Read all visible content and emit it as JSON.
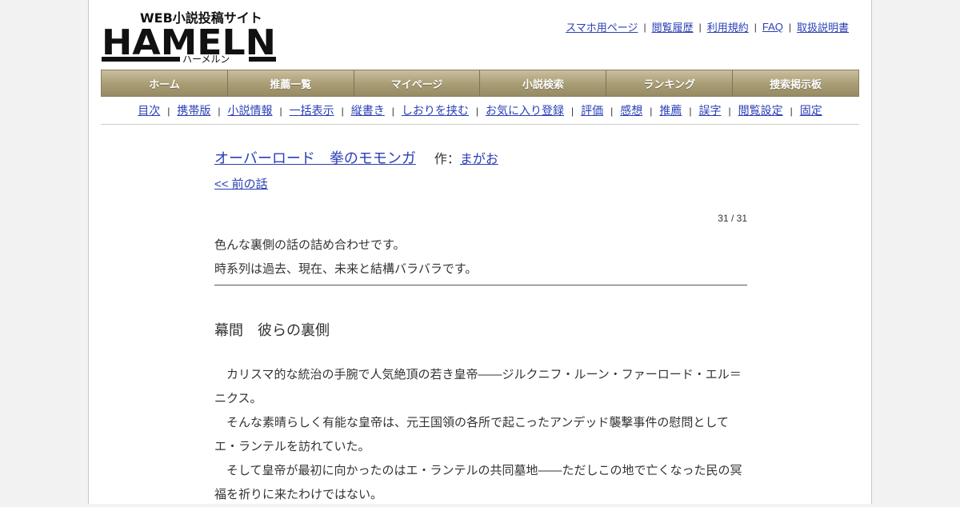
{
  "logo": {
    "tagline": "WEB小説投稿サイト",
    "name": "HAMELN",
    "kana": "ハーメルン"
  },
  "header_links": [
    "スマホ用ページ",
    "閲覧履歴",
    "利用規約",
    "FAQ",
    "取扱説明書"
  ],
  "nav": [
    "ホーム",
    "推薦一覧",
    "マイページ",
    "小説検索",
    "ランキング",
    "捜索掲示板"
  ],
  "subnav": [
    "目次",
    "携帯版",
    "小説情報",
    "一括表示",
    "縦書き",
    "しおりを挟む",
    "お気に入り登録",
    "評価",
    "感想",
    "推薦",
    "誤字",
    "閲覧設定",
    "固定"
  ],
  "novel": {
    "title": "オーバーロード　拳のモモンガ",
    "author_label": "作：",
    "author": "まがお",
    "prev_link": "<< 前の話",
    "pager": "31 / 31",
    "preface": [
      "色んな裏側の話の詰め合わせです。",
      "時系列は過去、現在、未来と結構バラバラです。"
    ],
    "chapter_title": "幕間　彼らの裏側",
    "body": [
      "　カリスマ的な統治の手腕で人気絶頂の若き皇帝――ジルクニフ・ルーン・ファーロード・エル＝ニクス。",
      "　そんな素晴らしく有能な皇帝は、元王国領の各所で起こったアンデッド襲撃事件の慰問として",
      "エ・ランテルを訪れていた。",
      "　そして皇帝が最初に向かったのはエ・ランテルの共同墓地――ただしこの地で亡くなった民の冥",
      "福を祈りに来たわけではない。"
    ]
  },
  "colors": {
    "link": "#2a3fb5",
    "nav_bg": "#a89c74"
  }
}
